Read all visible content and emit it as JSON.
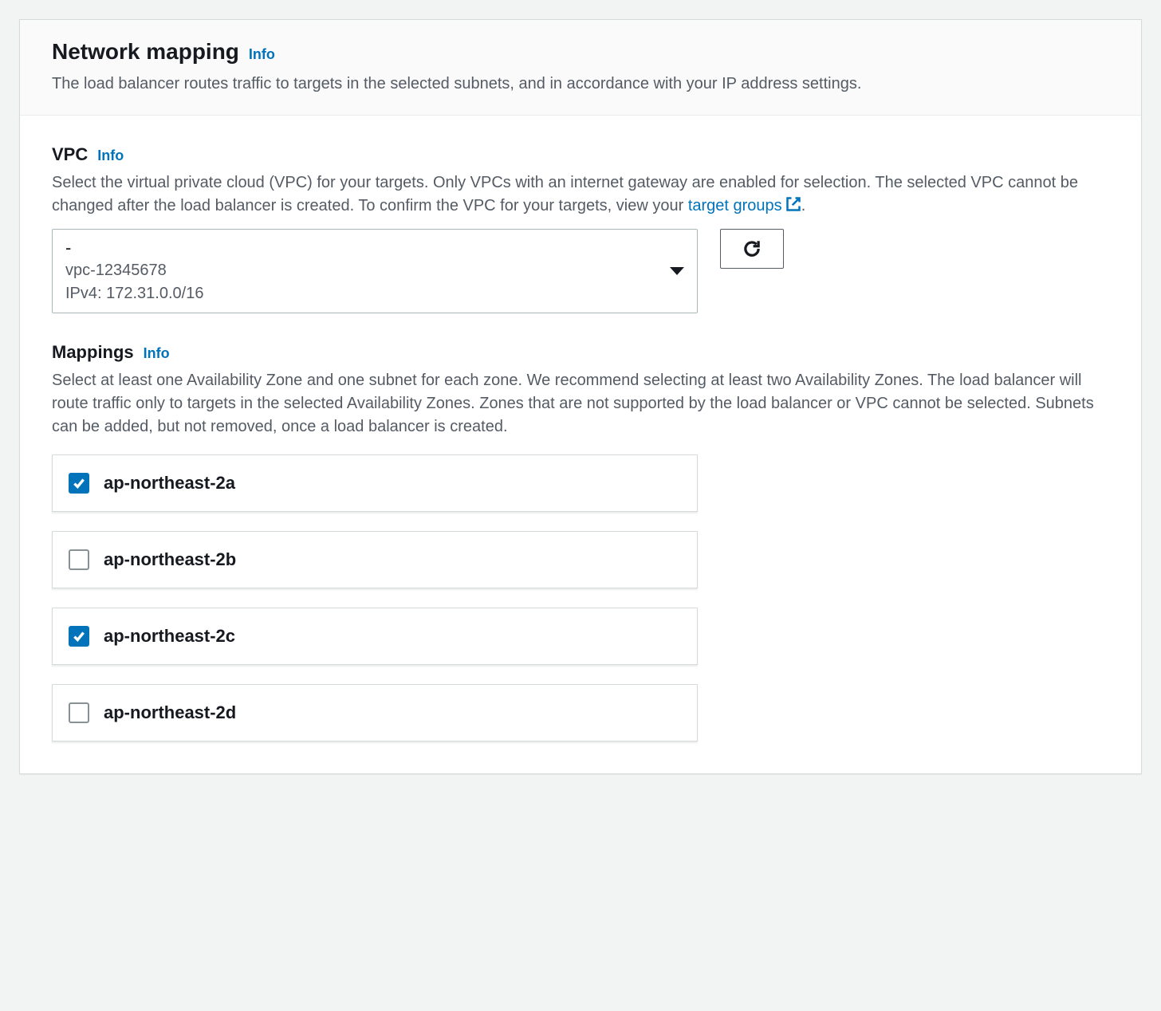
{
  "header": {
    "title": "Network mapping",
    "info": "Info",
    "description": "The load balancer routes traffic to targets in the selected subnets, and in accordance with your IP address settings."
  },
  "vpc": {
    "title": "VPC",
    "info": "Info",
    "description_part1": "Select the virtual private cloud (VPC) for your targets. Only VPCs with an internet gateway are enabled for selection. The selected VPC cannot be changed after the load balancer is created. To confirm the VPC for your targets, view your ",
    "description_linktext": "target groups",
    "description_part2": ".",
    "selected_main": "-",
    "selected_id": "vpc-12345678",
    "selected_cidr": "IPv4: 172.31.0.0/16"
  },
  "mappings": {
    "title": "Mappings",
    "info": "Info",
    "description": "Select at least one Availability Zone and one subnet for each zone. We recommend selecting at least two Availability Zones. The load balancer will route traffic only to targets in the selected Availability Zones. Zones that are not supported by the load balancer or VPC cannot be selected. Subnets can be added, but not removed, once a load balancer is created.",
    "zones": [
      {
        "label": "ap-northeast-2a",
        "checked": true
      },
      {
        "label": "ap-northeast-2b",
        "checked": false
      },
      {
        "label": "ap-northeast-2c",
        "checked": true
      },
      {
        "label": "ap-northeast-2d",
        "checked": false
      }
    ]
  }
}
